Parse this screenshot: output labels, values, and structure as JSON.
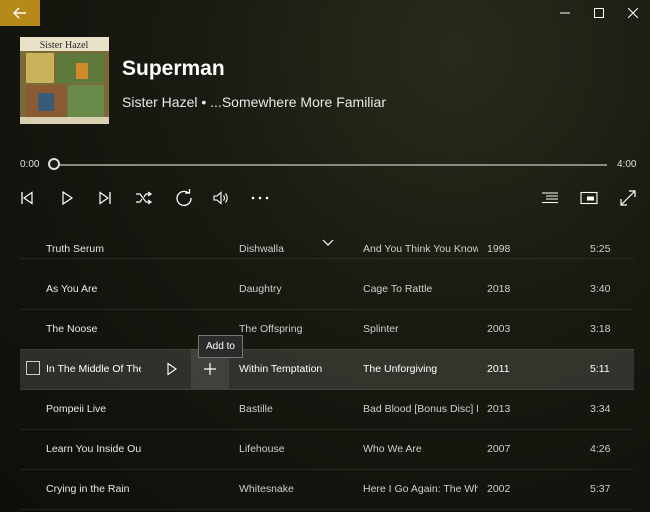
{
  "window": {
    "back_icon": "arrow-left-icon",
    "minimize_icon": "minimize-icon",
    "maximize_icon": "maximize-icon",
    "close_icon": "close-icon",
    "accent": "#b58a1a"
  },
  "now_playing": {
    "title": "Superman",
    "subtitle": "Sister Hazel • ...Somewhere More Familiar",
    "album_art_text": "Sister Hazel",
    "time_elapsed": "0:00",
    "time_total": "4:00",
    "progress": 0
  },
  "controls": {
    "previous_icon": "skip-previous-icon",
    "play_icon": "play-icon",
    "next_icon": "skip-next-icon",
    "shuffle_icon": "shuffle-icon",
    "repeat_icon": "repeat-icon",
    "volume_icon": "volume-icon",
    "more_icon": "more-icon",
    "queue_icon": "queue-list-icon",
    "miniplayer_icon": "mini-player-icon",
    "fullscreen_icon": "fullscreen-icon"
  },
  "tooltip": {
    "text": "Add to"
  },
  "tracks": [
    {
      "title": "Truth Serum",
      "artist": "Dishwalla",
      "album": "And You Think You Know",
      "year": "1998",
      "duration": "5:25",
      "partial": true
    },
    {
      "title": "As You Are",
      "artist": "Daughtry",
      "album": "Cage To Rattle",
      "year": "2018",
      "duration": "3:40"
    },
    {
      "title": "The Noose",
      "artist": "The Offspring",
      "album": "Splinter",
      "year": "2003",
      "duration": "3:18"
    },
    {
      "title": "In The Middle Of The Night",
      "artist": "Within Temptation",
      "album": "The Unforgiving",
      "year": "2011",
      "duration": "5:11",
      "selected": true
    },
    {
      "title": "Pompeii Live",
      "artist": "Bastille",
      "album": "Bad Blood [Bonus Disc] Live",
      "year": "2013",
      "duration": "3:34"
    },
    {
      "title": "Learn You Inside Out",
      "artist": "Lifehouse",
      "album": "Who We Are",
      "year": "2007",
      "duration": "4:26"
    },
    {
      "title": "Crying in the Rain",
      "artist": "Whitesnake",
      "album": "Here I Go Again: The Whitesnake Collection",
      "year": "2002",
      "duration": "5:37"
    }
  ]
}
